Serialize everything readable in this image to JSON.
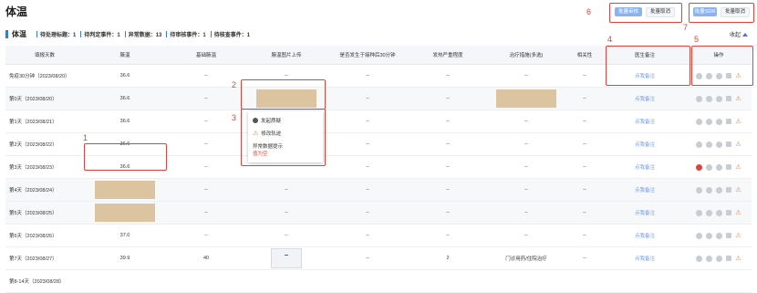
{
  "page_title": "体温",
  "summary": {
    "section_label": "体温",
    "stats": [
      {
        "label": "待处理标题：1"
      },
      {
        "label": "待判定事件：1"
      },
      {
        "label": "异常数据：13"
      },
      {
        "label": "待审核事件：1"
      },
      {
        "label": "待核查事件：1"
      }
    ]
  },
  "collapse_label": "收起",
  "toolbar_left": {
    "approve_label": "批量审核",
    "cancel_label": "批量取消"
  },
  "toolbar_right": {
    "sdr_label": "批量SDR",
    "cancel_label": "批量取消"
  },
  "annotations": [
    "1",
    "2",
    "3",
    "4",
    "5",
    "6",
    "7"
  ],
  "table": {
    "headers": [
      "填报天数",
      "腋温",
      "基础腋温",
      "腋温图片上传",
      "是否发生于接种后30分钟",
      "发热严重程度",
      "治疗措施(多选)",
      "相关性",
      "医生备注",
      "操作"
    ],
    "rows": [
      {
        "day": "免疫30分钟（2023/08/20）",
        "temp": "36.6",
        "base": "--",
        "img": "--",
        "after30": "--",
        "severity": "--",
        "treat": "--",
        "relate": "--",
        "note": "点我备注"
      },
      {
        "day": "第0天（2023/08/20）",
        "temp": "36.6",
        "base": "--",
        "img": "",
        "after30": "--",
        "severity": "--",
        "treat": "",
        "relate": "--",
        "note": "点我备注"
      },
      {
        "day": "第1天（2023/08/21）",
        "temp": "36.6",
        "base": "--",
        "img": "",
        "after30": "--",
        "severity": "--",
        "treat": "--",
        "relate": "--",
        "note": "点我备注"
      },
      {
        "day": "第2天（2023/08/22）",
        "temp": "36.6",
        "base": "--",
        "img": "",
        "after30": "--",
        "severity": "--",
        "treat": "--",
        "relate": "--",
        "note": "点我备注"
      },
      {
        "day": "第3天（2023/08/23）",
        "temp": "36.6",
        "base": "--",
        "img": "",
        "after30": "--",
        "severity": "--",
        "treat": "--",
        "relate": "--",
        "note": "点我备注"
      },
      {
        "day": "第4天（2023/08/24）",
        "temp": "",
        "base": "--",
        "img": "--",
        "after30": "--",
        "severity": "--",
        "treat": "--",
        "relate": "--",
        "note": "点我备注"
      },
      {
        "day": "第5天（2023/08/25）",
        "temp": "",
        "base": "--",
        "img": "--",
        "after30": "--",
        "severity": "--",
        "treat": "--",
        "relate": "--",
        "note": "点我备注"
      },
      {
        "day": "第6天（2023/08/26）",
        "temp": "37.0",
        "base": "--",
        "img": "--",
        "after30": "--",
        "severity": "--",
        "treat": "--",
        "relate": "--",
        "note": "点我备注"
      },
      {
        "day": "第7天（2023/08/27）",
        "temp": "39.9",
        "base": "40",
        "img": "",
        "after30": "--",
        "severity": "2",
        "treat": "门诊用药/住院治疗",
        "relate": "--",
        "note": "点我备注"
      },
      {
        "day": "第8-14天（2023/08/28）",
        "temp": "",
        "base": "",
        "img": "",
        "after30": "",
        "severity": "",
        "treat": "",
        "relate": "",
        "note": ""
      }
    ]
  },
  "popup": {
    "item1": "发起质疑",
    "item2": "修改轨迹",
    "item3": "异常数据提示",
    "item3_detail": "值为空"
  }
}
